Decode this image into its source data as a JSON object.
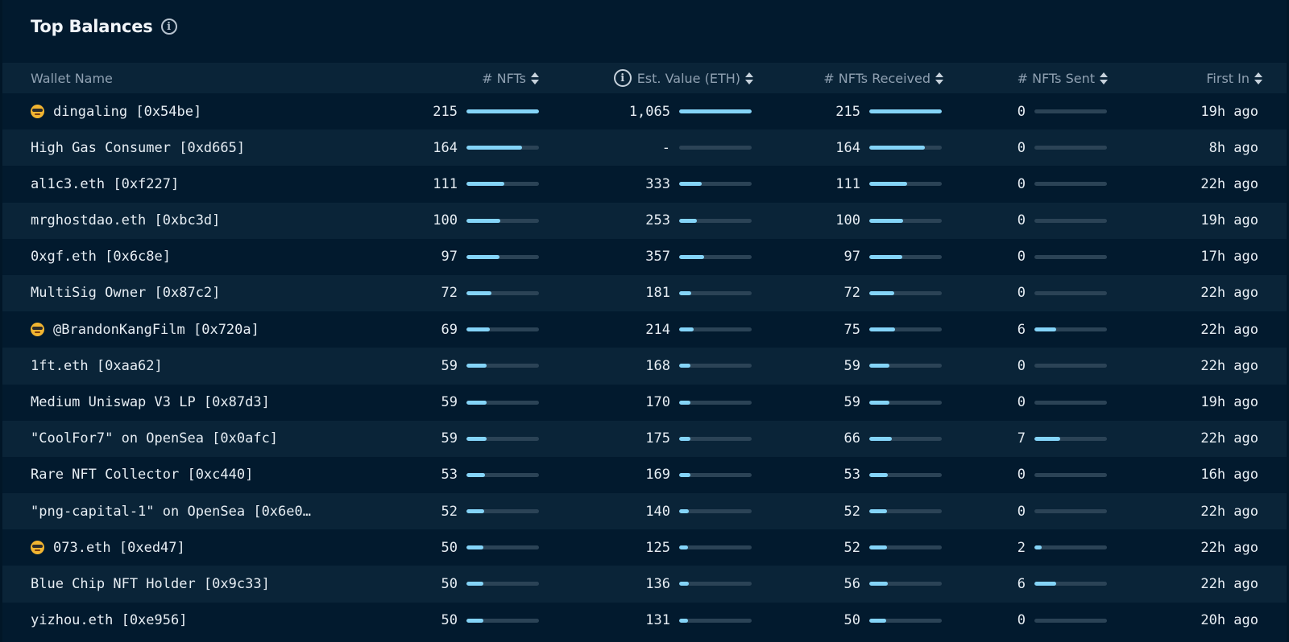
{
  "panel": {
    "title": "Top Balances"
  },
  "columns": {
    "wallet_name": "Wallet Name",
    "nfts": "# NFTs",
    "est_value": "Est. Value (ETH)",
    "received": "# NFTs Received",
    "sent": "# NFTs Sent",
    "first_in": "First In"
  },
  "colors": {
    "bar_fill": "#84d4f8",
    "bar_track": "#2b4356",
    "row_alt": "#0a2438",
    "background": "#021a2e"
  },
  "rows": [
    {
      "emoji": true,
      "name": "dingaling [0x54be]",
      "nfts": "215",
      "nfts_frac": 1.0,
      "value": "1,065",
      "value_frac": 1.0,
      "received": "215",
      "received_frac": 1.0,
      "sent": "0",
      "sent_frac": 0,
      "first_in": "19h ago"
    },
    {
      "emoji": false,
      "name": "High Gas Consumer [0xd665]",
      "nfts": "164",
      "nfts_frac": 0.77,
      "value": "-",
      "value_frac": 0,
      "received": "164",
      "received_frac": 0.77,
      "sent": "0",
      "sent_frac": 0,
      "first_in": "8h ago"
    },
    {
      "emoji": false,
      "name": "al1c3.eth [0xf227]",
      "nfts": "111",
      "nfts_frac": 0.52,
      "value": "333",
      "value_frac": 0.31,
      "received": "111",
      "received_frac": 0.52,
      "sent": "0",
      "sent_frac": 0,
      "first_in": "22h ago"
    },
    {
      "emoji": false,
      "name": "mrghostdao.eth [0xbc3d]",
      "nfts": "100",
      "nfts_frac": 0.47,
      "value": "253",
      "value_frac": 0.24,
      "received": "100",
      "received_frac": 0.47,
      "sent": "0",
      "sent_frac": 0,
      "first_in": "19h ago"
    },
    {
      "emoji": false,
      "name": "0xgf.eth [0x6c8e]",
      "nfts": "97",
      "nfts_frac": 0.45,
      "value": "357",
      "value_frac": 0.34,
      "received": "97",
      "received_frac": 0.45,
      "sent": "0",
      "sent_frac": 0,
      "first_in": "17h ago"
    },
    {
      "emoji": false,
      "name": "MultiSig Owner [0x87c2]",
      "nfts": "72",
      "nfts_frac": 0.34,
      "value": "181",
      "value_frac": 0.17,
      "received": "72",
      "received_frac": 0.34,
      "sent": "0",
      "sent_frac": 0,
      "first_in": "22h ago"
    },
    {
      "emoji": true,
      "name": "@BrandonKangFilm [0x720a]",
      "nfts": "69",
      "nfts_frac": 0.32,
      "value": "214",
      "value_frac": 0.2,
      "received": "75",
      "received_frac": 0.35,
      "sent": "6",
      "sent_frac": 0.3,
      "first_in": "22h ago"
    },
    {
      "emoji": false,
      "name": "1ft.eth [0xaa62]",
      "nfts": "59",
      "nfts_frac": 0.28,
      "value": "168",
      "value_frac": 0.16,
      "received": "59",
      "received_frac": 0.28,
      "sent": "0",
      "sent_frac": 0,
      "first_in": "22h ago"
    },
    {
      "emoji": false,
      "name": "Medium Uniswap V3 LP [0x87d3]",
      "nfts": "59",
      "nfts_frac": 0.28,
      "value": "170",
      "value_frac": 0.16,
      "received": "59",
      "received_frac": 0.28,
      "sent": "0",
      "sent_frac": 0,
      "first_in": "19h ago"
    },
    {
      "emoji": false,
      "name": "\"CoolFor7\" on OpenSea [0x0afc]",
      "nfts": "59",
      "nfts_frac": 0.28,
      "value": "175",
      "value_frac": 0.16,
      "received": "66",
      "received_frac": 0.31,
      "sent": "7",
      "sent_frac": 0.35,
      "first_in": "22h ago"
    },
    {
      "emoji": false,
      "name": "Rare NFT Collector [0xc440]",
      "nfts": "53",
      "nfts_frac": 0.25,
      "value": "169",
      "value_frac": 0.16,
      "received": "53",
      "received_frac": 0.25,
      "sent": "0",
      "sent_frac": 0,
      "first_in": "16h ago"
    },
    {
      "emoji": false,
      "name": "\"png-capital-1\" on OpenSea [0x6e0…",
      "nfts": "52",
      "nfts_frac": 0.24,
      "value": "140",
      "value_frac": 0.13,
      "received": "52",
      "received_frac": 0.24,
      "sent": "0",
      "sent_frac": 0,
      "first_in": "22h ago"
    },
    {
      "emoji": true,
      "name": "073.eth [0xed47]",
      "nfts": "50",
      "nfts_frac": 0.23,
      "value": "125",
      "value_frac": 0.12,
      "received": "52",
      "received_frac": 0.24,
      "sent": "2",
      "sent_frac": 0.1,
      "first_in": "22h ago"
    },
    {
      "emoji": false,
      "name": "Blue Chip NFT Holder [0x9c33]",
      "nfts": "50",
      "nfts_frac": 0.23,
      "value": "136",
      "value_frac": 0.13,
      "received": "56",
      "received_frac": 0.26,
      "sent": "6",
      "sent_frac": 0.3,
      "first_in": "22h ago"
    },
    {
      "emoji": false,
      "name": "yizhou.eth [0xe956]",
      "nfts": "50",
      "nfts_frac": 0.23,
      "value": "131",
      "value_frac": 0.12,
      "received": "50",
      "received_frac": 0.23,
      "sent": "0",
      "sent_frac": 0,
      "first_in": "20h ago"
    }
  ]
}
